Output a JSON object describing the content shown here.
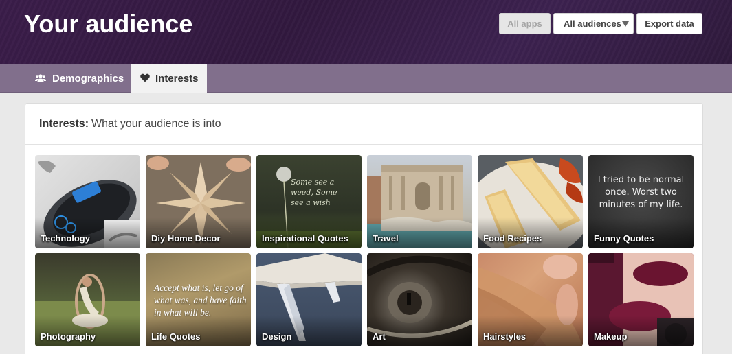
{
  "header": {
    "title": "Your audience",
    "buttons": {
      "all_apps": "All apps",
      "all_audiences": "All audiences",
      "export": "Export data"
    }
  },
  "tabs": {
    "demographics": "Demographics",
    "interests": "Interests"
  },
  "card": {
    "title_bold": "Interests:",
    "title_rest": "What your audience is into"
  },
  "tiles": [
    {
      "label": "Technology"
    },
    {
      "label": "Diy Home Decor"
    },
    {
      "label": "Inspirational Quotes",
      "quote": "Some see a weed, Some see a wish"
    },
    {
      "label": "Travel"
    },
    {
      "label": "Food Recipes"
    },
    {
      "label": "Funny Quotes",
      "quote": "I tried to be normal once. Worst two minutes of my life."
    },
    {
      "label": "Photography"
    },
    {
      "label": "Life Quotes",
      "quote": "Accept what is, let go of what was, and have faith in what will be."
    },
    {
      "label": "Design"
    },
    {
      "label": "Art"
    },
    {
      "label": "Hairstyles"
    },
    {
      "label": "Makeup"
    }
  ],
  "colors": {
    "header_bg": "#3b1d4a",
    "tabbar_bg": "#816f8c",
    "active_tab_bg": "#f2f2f2"
  }
}
